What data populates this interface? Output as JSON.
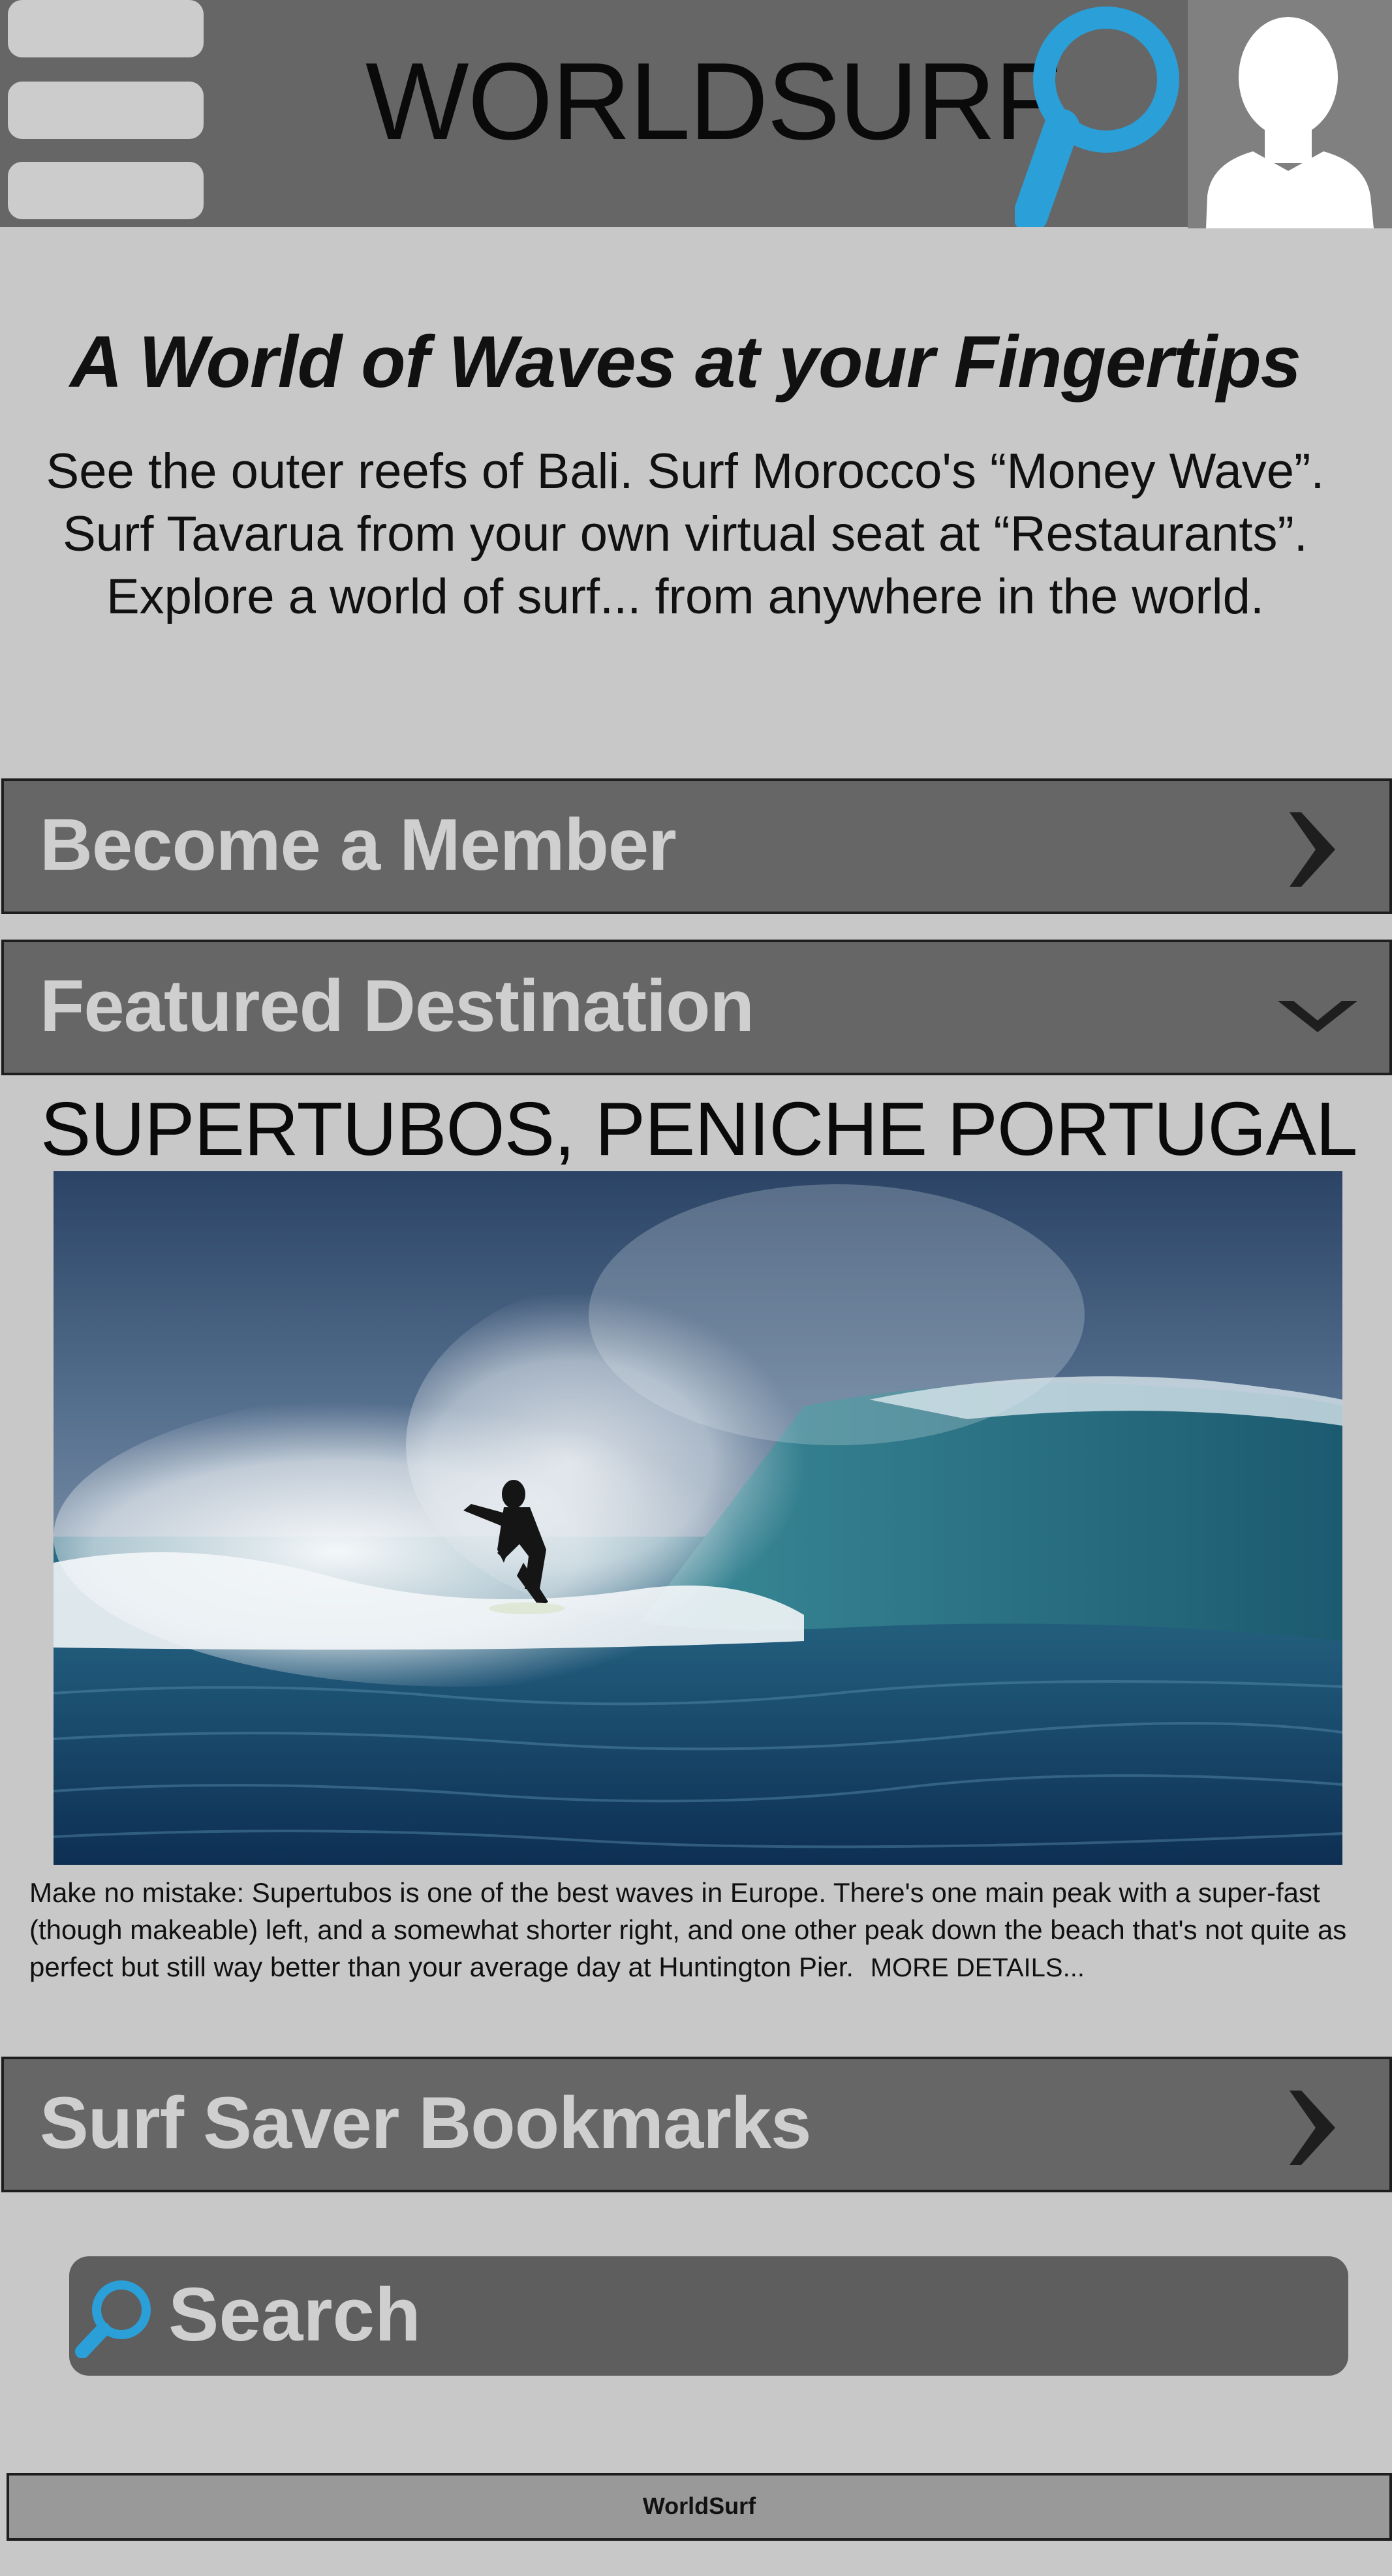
{
  "app": {
    "title": "WORLDSURF"
  },
  "intro": {
    "headline": "A World of Waves at your Fingertips",
    "body": "See the outer reefs of Bali. Surf Morocco's “Money Wave”. Surf Tavarua from your own virtual seat at “Restaurants”. Explore a world of surf... from anywhere in the world."
  },
  "sections": {
    "member": {
      "label": "Become a Member",
      "state": "collapsed"
    },
    "featured": {
      "label": "Featured Destination",
      "state": "expanded"
    },
    "bookmarks": {
      "label": "Surf Saver Bookmarks",
      "state": "collapsed"
    }
  },
  "featured": {
    "title": "SUPERTUBOS, PENICHE PORTUGAL",
    "description": "Make no mistake: Supertubos is one of the best waves in Europe. There's one main peak with a super-fast (though makeable) left, and a somewhat shorter right, and one other peak down the beach that's not quite as perfect but still way better than your average day at Huntington Pier.",
    "more_link": "MORE DETAILS..."
  },
  "search": {
    "placeholder": "Search"
  },
  "footer": {
    "text": "WorldSurf"
  },
  "icons": {
    "menu": "hamburger-menu-icon",
    "search": "magnifier-icon",
    "profile": "user-silhouette-icon",
    "chevron_right": "chevron-right-icon",
    "chevron_down": "chevron-down-icon"
  },
  "colors": {
    "accent": "#2a9fd8",
    "bar": "#666666",
    "page_bg": "#c8c8c8",
    "bar_text": "#cfcfcf"
  }
}
